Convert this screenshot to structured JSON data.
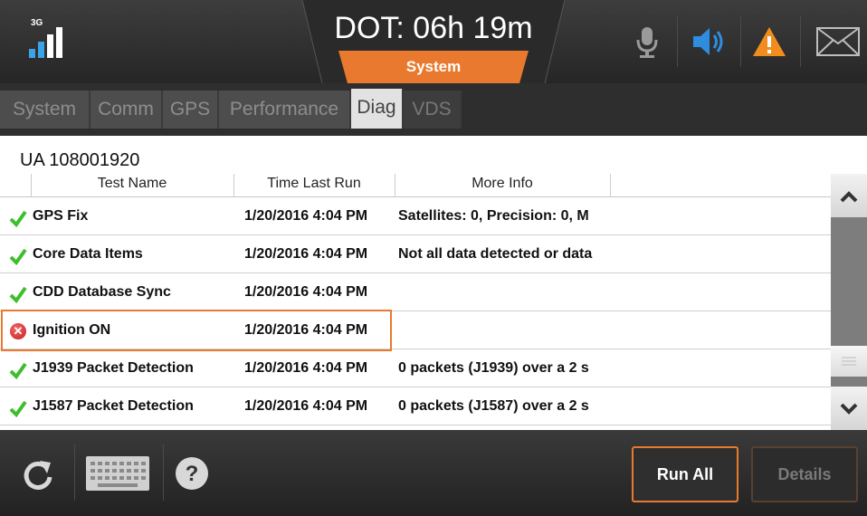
{
  "header": {
    "network": "3G",
    "dot_label": "DOT: 06h 19m",
    "dot_sub": "System"
  },
  "tabs": [
    "System",
    "Comm",
    "GPS",
    "Performance",
    "Diag",
    "VDS"
  ],
  "active_tab": "Diag",
  "unit_id": "UA 108001920",
  "columns": [
    "Test Name",
    "Time Last Run",
    "More Info"
  ],
  "rows": [
    {
      "status": "pass",
      "name": "GPS Fix",
      "time": "1/20/2016 4:04 PM",
      "info": "Satellites: 0, Precision: 0, M"
    },
    {
      "status": "pass",
      "name": "Core Data Items",
      "time": "1/20/2016 4:04 PM",
      "info": "Not all data detected or data"
    },
    {
      "status": "pass",
      "name": "CDD Database Sync",
      "time": "1/20/2016 4:04 PM",
      "info": ""
    },
    {
      "status": "fail",
      "name": "Ignition ON",
      "time": "1/20/2016 4:04 PM",
      "info": ""
    },
    {
      "status": "pass",
      "name": "J1939 Packet Detection",
      "time": "1/20/2016 4:04 PM",
      "info": "0 packets (J1939) over a 2 s"
    },
    {
      "status": "pass",
      "name": "J1587 Packet Detection",
      "time": "1/20/2016 4:04 PM",
      "info": "0 packets (J1587) over a 2 s"
    }
  ],
  "buttons": {
    "run_all": "Run All",
    "details": "Details"
  },
  "colors": {
    "accent": "#e8792e",
    "signal": "#3da3e8",
    "speaker": "#2f8de0",
    "warning": "#f28c1c",
    "pass": "#3bbf2a",
    "fail": "#d02020"
  },
  "icons": [
    "signal-icon",
    "microphone-icon",
    "speaker-icon",
    "warning-icon",
    "mail-icon",
    "refresh-icon",
    "keyboard-icon",
    "help-icon",
    "chevron-up-icon",
    "chevron-down-icon"
  ]
}
